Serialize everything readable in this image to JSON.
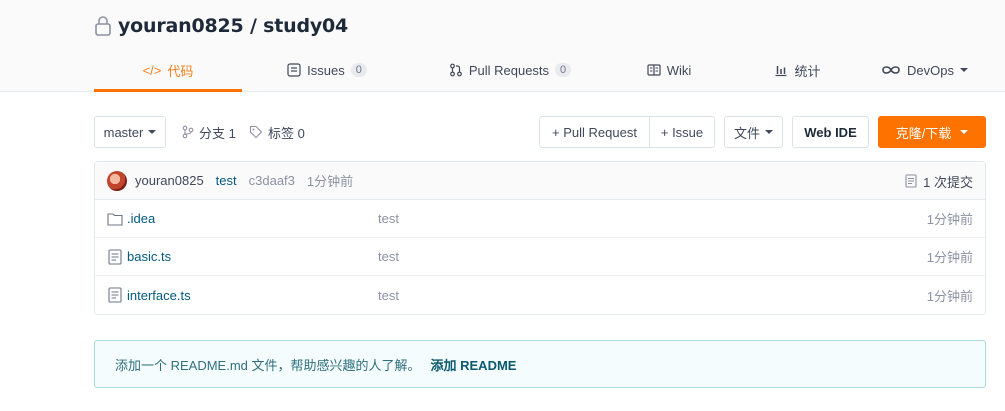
{
  "repo": {
    "owner_repo": "youran0825 / study04"
  },
  "tabs": [
    {
      "label": "代码",
      "icon": "code-icon"
    },
    {
      "label": "Issues",
      "badge": "0",
      "icon": "issues-icon"
    },
    {
      "label": "Pull Requests",
      "badge": "0",
      "icon": "pull-request-icon"
    },
    {
      "label": "Wiki",
      "icon": "wiki-icon"
    },
    {
      "label": "统计",
      "icon": "stats-icon"
    },
    {
      "label": "DevOps",
      "icon": "devops-icon"
    }
  ],
  "toolbar": {
    "branch": "master",
    "branches_label": "分支 1",
    "tags_label": "标签 0",
    "pull_request": "+ Pull Request",
    "issue": "+ Issue",
    "file": "文件",
    "web_ide": "Web IDE",
    "clone": "克隆/下载"
  },
  "commit": {
    "user": "youran0825",
    "message": "test",
    "sha": "c3daaf3",
    "time": "1分钟前",
    "count": "1 次提交"
  },
  "files": [
    {
      "name": ".idea",
      "type": "folder",
      "message": "test",
      "time": "1分钟前"
    },
    {
      "name": "basic.ts",
      "type": "file",
      "message": "test",
      "time": "1分钟前"
    },
    {
      "name": "interface.ts",
      "type": "file",
      "message": "test",
      "time": "1分钟前"
    }
  ],
  "readme_tip": {
    "text": "添加一个 README.md 文件，帮助感兴趣的人了解。",
    "link": "添加 README"
  },
  "colors": {
    "accent": "#fe7300",
    "link": "#005980"
  }
}
